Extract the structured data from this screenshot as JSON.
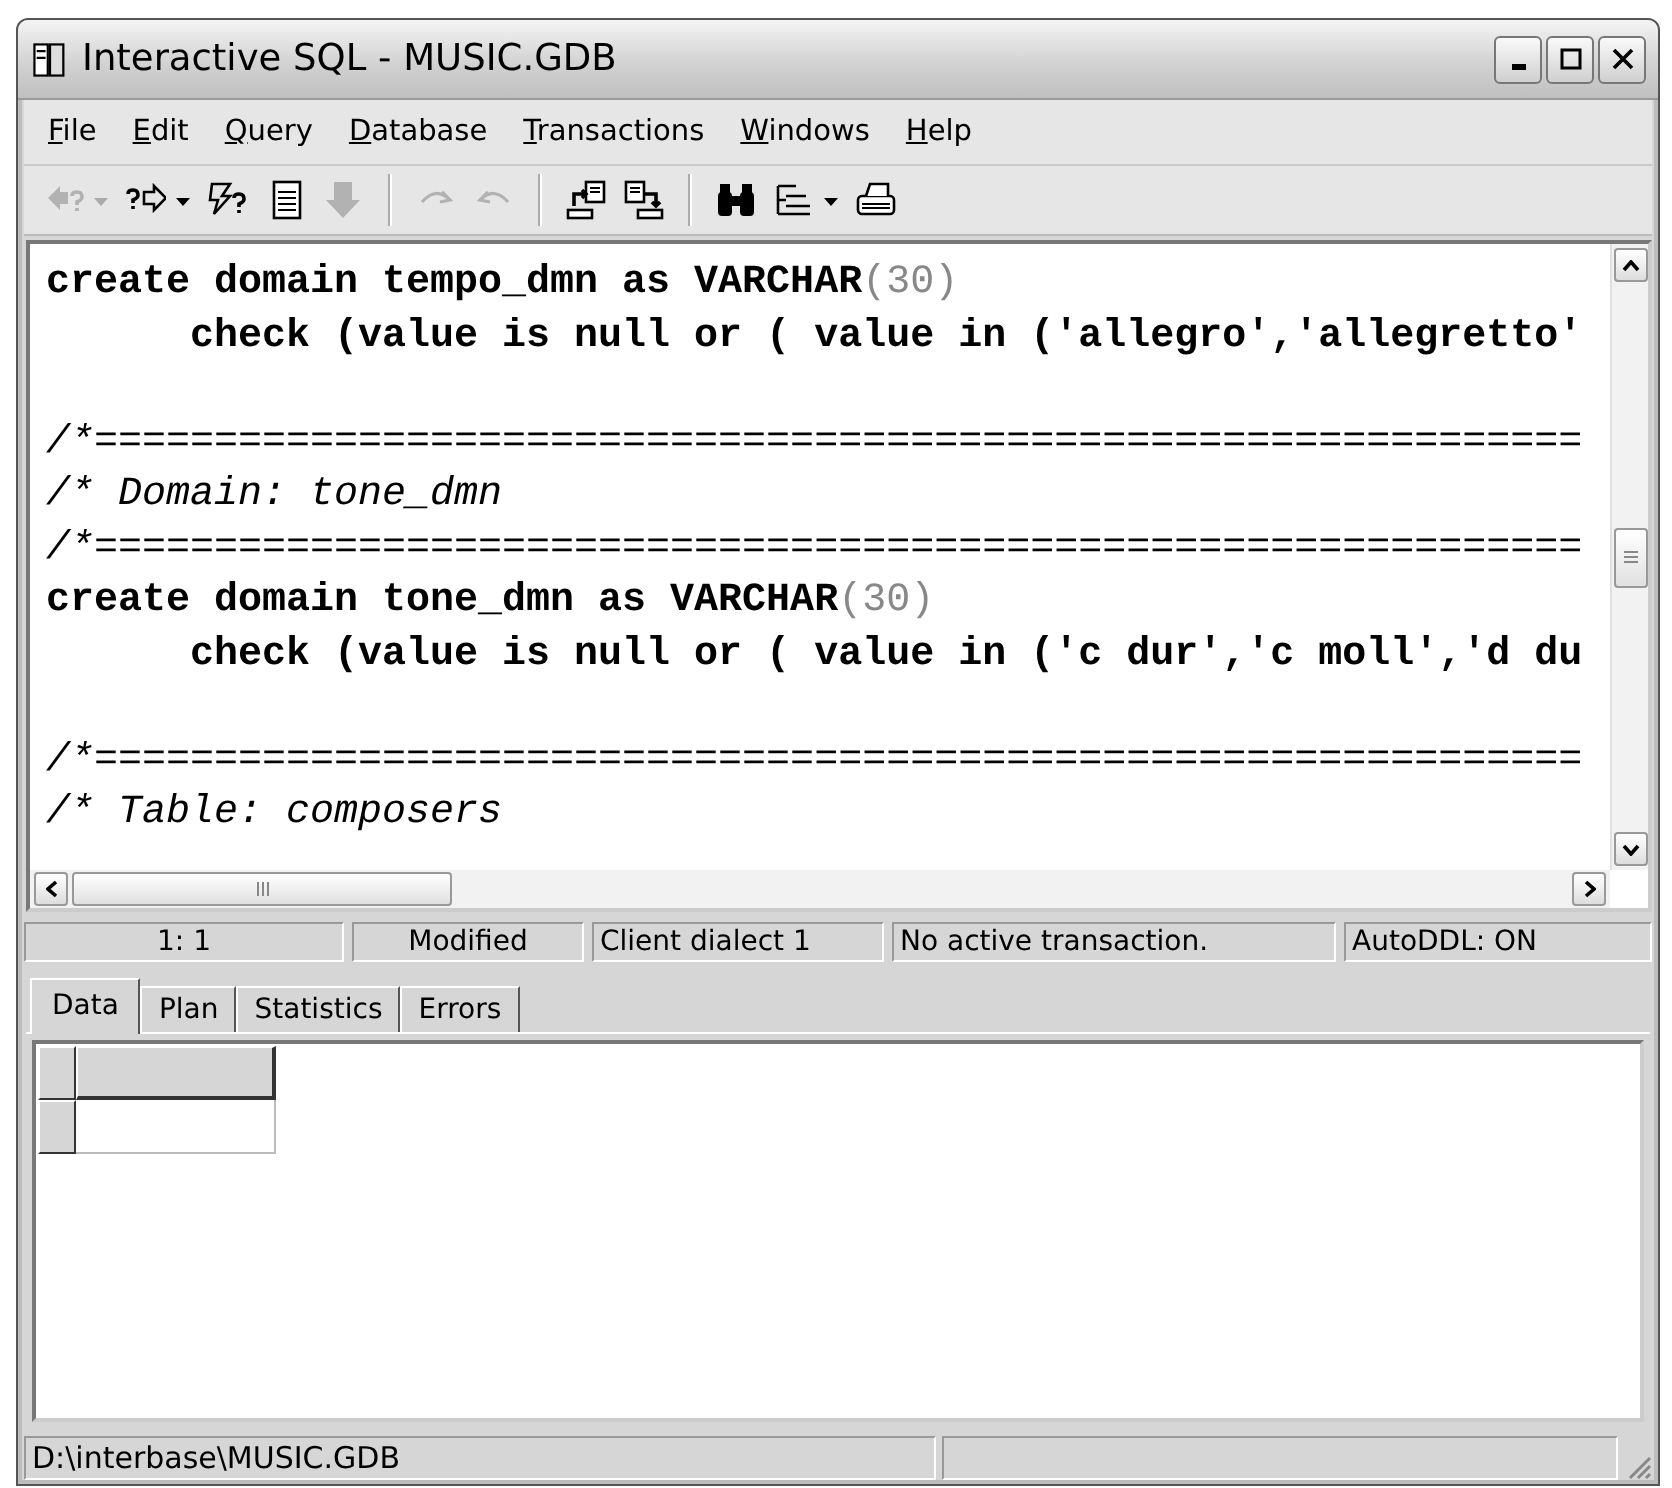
{
  "window": {
    "title": "Interactive SQL - MUSIC.GDB"
  },
  "menu": [
    "File",
    "Edit",
    "Query",
    "Database",
    "Transactions",
    "Windows",
    "Help"
  ],
  "toolbar": [
    {
      "kind": "button",
      "disabled": true
    },
    {
      "kind": "dropdown",
      "disabled": true
    },
    {
      "kind": "button",
      "disabled": false
    },
    {
      "kind": "dropdown",
      "disabled": false
    },
    {
      "kind": "button",
      "disabled": false
    },
    {
      "kind": "button",
      "disabled": false
    },
    {
      "kind": "button",
      "disabled": true
    },
    {
      "kind": "separator"
    },
    {
      "kind": "button",
      "disabled": true
    },
    {
      "kind": "button",
      "disabled": true
    },
    {
      "kind": "separator"
    },
    {
      "kind": "button",
      "disabled": false
    },
    {
      "kind": "button",
      "disabled": false
    },
    {
      "kind": "separator"
    },
    {
      "kind": "button",
      "disabled": false
    },
    {
      "kind": "button",
      "disabled": false
    },
    {
      "kind": "dropdown",
      "disabled": false
    },
    {
      "kind": "button",
      "disabled": false
    }
  ],
  "editor": {
    "lines": [
      {
        "kind": "text",
        "segments": [
          {
            "kind": "code",
            "text": "create domain tempo_dmn as VARCHAR"
          },
          {
            "kind": "number",
            "text": "(30)"
          }
        ]
      },
      {
        "kind": "text",
        "segments": [
          {
            "kind": "code",
            "text": "      check (value is null or ( value in ('allegro','allegretto'"
          }
        ]
      },
      {
        "kind": "blank"
      },
      {
        "kind": "text",
        "segments": [
          {
            "kind": "comment",
            "text": "/*=============================================================="
          }
        ]
      },
      {
        "kind": "text",
        "segments": [
          {
            "kind": "comment",
            "text": "/* Domain: tone_dmn"
          }
        ]
      },
      {
        "kind": "text",
        "segments": [
          {
            "kind": "comment",
            "text": "/*=============================================================="
          }
        ]
      },
      {
        "kind": "text",
        "segments": [
          {
            "kind": "code",
            "text": "create domain tone_dmn as VARCHAR"
          },
          {
            "kind": "number",
            "text": "(30)"
          }
        ]
      },
      {
        "kind": "text",
        "segments": [
          {
            "kind": "code",
            "text": "      check (value is null or ( value in ('c dur','c moll','d du"
          }
        ]
      },
      {
        "kind": "blank"
      },
      {
        "kind": "text",
        "segments": [
          {
            "kind": "comment",
            "text": "/*=============================================================="
          }
        ]
      },
      {
        "kind": "text",
        "segments": [
          {
            "kind": "comment",
            "text": "/* Table: composers"
          }
        ]
      }
    ]
  },
  "status_bar": [
    "1: 1",
    "Modified",
    "Client dialect 1",
    "No active transaction.",
    "AutoDDL: ON"
  ],
  "tabs": [
    {
      "label": "Data",
      "selected": true
    },
    {
      "label": "Plan",
      "selected": false
    },
    {
      "label": "Statistics",
      "selected": false
    },
    {
      "label": "Errors",
      "selected": false
    }
  ],
  "bottom_status": [
    "D:\\interbase\\MUSIC.GDB"
  ]
}
